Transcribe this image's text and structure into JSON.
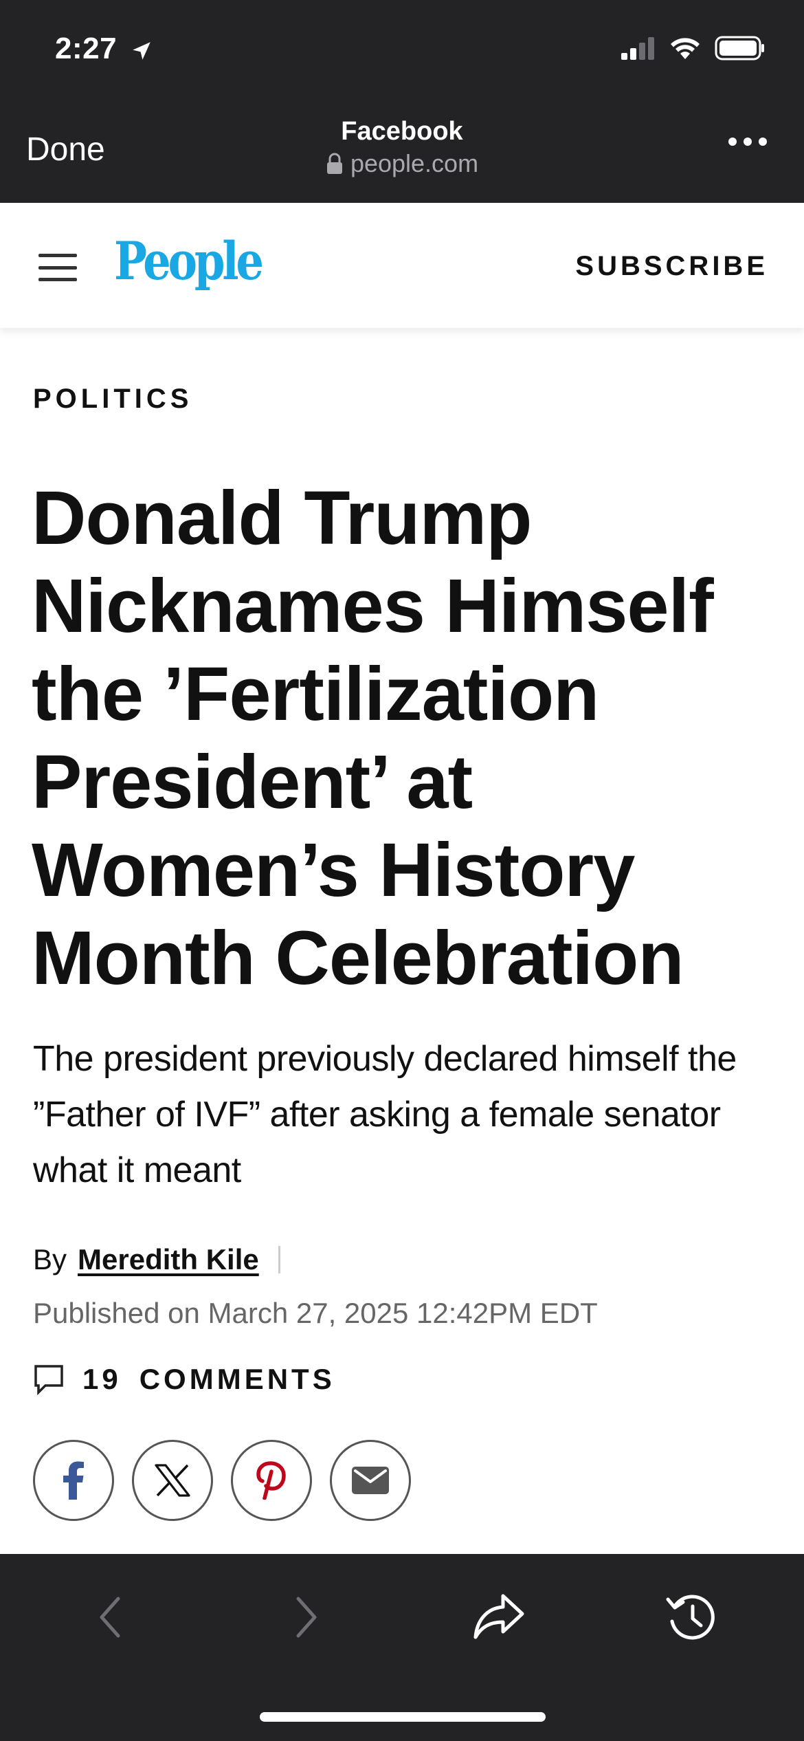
{
  "status_bar": {
    "time": "2:27",
    "icons": [
      "location-arrow-icon",
      "signal-icon",
      "wifi-icon",
      "battery-icon"
    ]
  },
  "browser": {
    "done_label": "Done",
    "page_title": "Facebook",
    "url": "people.com",
    "more_icon": "ellipsis-icon"
  },
  "site_header": {
    "logo": "People",
    "subscribe_label": "SUBSCRIBE",
    "logo_color": "#1aa8e4"
  },
  "article": {
    "category": "POLITICS",
    "headline": "Donald Trump Nicknames Himself the ’Fertilization President’ at Women’s History Month Celebration",
    "dek": "The president previously declared himself the ”Father of IVF” after asking a female senator what it meant",
    "by_label": "By",
    "author": "Meredith Kile",
    "published": "Published on March 27, 2025 12:42PM EDT",
    "comments_count": "19",
    "comments_label": "COMMENTS"
  },
  "share": [
    {
      "name": "facebook-share-button",
      "icon": "facebook-icon"
    },
    {
      "name": "x-share-button",
      "icon": "x-icon"
    },
    {
      "name": "pinterest-share-button",
      "icon": "pinterest-icon"
    },
    {
      "name": "email-share-button",
      "icon": "mail-icon"
    }
  ],
  "toolbar": {
    "items": [
      "back-arrow-icon",
      "forward-arrow-icon",
      "share-arrow-icon",
      "history-icon"
    ]
  },
  "colors": {
    "chrome_bg": "#232326",
    "facebook": "#3b5998",
    "pinterest": "#bd081c"
  }
}
